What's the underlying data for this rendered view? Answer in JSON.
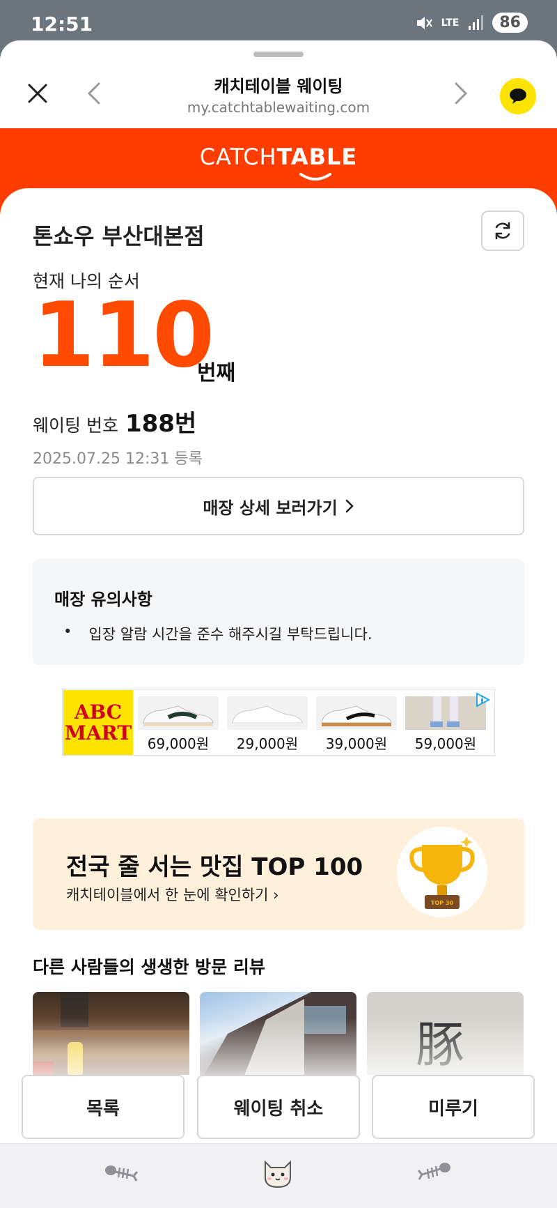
{
  "status_bar": {
    "time": "12:51",
    "network": "LTE",
    "battery": "86"
  },
  "browser": {
    "title": "캐치테이블 웨이팅",
    "url": "my.catchtablewaiting.com"
  },
  "brand": {
    "logo_light": "CATCH",
    "logo_bold": "TABLE",
    "color": "#ff3d00"
  },
  "waiting": {
    "store_name": "톤쇼우 부산대본점",
    "order_label": "현재 나의 순서",
    "order_number": "110",
    "order_suffix": "번째",
    "waiting_label": "웨이팅 번호",
    "waiting_number": "188번",
    "registered": "2025.07.25 12:31 등록",
    "detail_button": "매장 상세 보러가기"
  },
  "notice": {
    "title": "매장 유의사항",
    "bullet": "•",
    "items": [
      "입장 알람 시간을 준수 해주시길 부탁드립니다."
    ]
  },
  "ad": {
    "brand_line1": "ABC",
    "brand_line2": "MART",
    "products": [
      {
        "price": "69,000원"
      },
      {
        "price": "29,000원"
      },
      {
        "price": "39,000원"
      },
      {
        "price": "59,000원"
      }
    ]
  },
  "promo": {
    "title": "전국 줄 서는 맛집 TOP 100",
    "subtitle": "캐치테이블에서 한 눈에 확인하기 ›",
    "badge": "TOP 30"
  },
  "reviews": {
    "title": "다른 사람들의 생생한 방문 리뷰",
    "thumb3_char": "豚"
  },
  "actions": {
    "list": "목록",
    "cancel": "웨이팅 취소",
    "postpone": "미루기"
  },
  "colors": {
    "accent": "#ff4a00",
    "kakao": "#fee500"
  }
}
